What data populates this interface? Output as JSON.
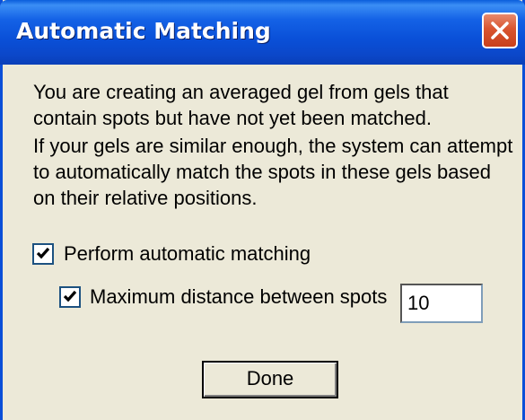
{
  "dialog": {
    "title": "Automatic Matching",
    "paragraph1_line1": "You are creating an averaged gel from gels that",
    "paragraph1_line2": "contain spots but have not yet been matched.",
    "paragraph2_line1": "If your gels are similar enough, the system can attempt",
    "paragraph2_line2": "to automatically match the spots in these gels based",
    "paragraph2_line3": "on their relative positions.",
    "auto_match_checkbox": {
      "label": "Perform automatic matching",
      "checked": true
    },
    "max_distance_checkbox": {
      "label": "Maximum distance between spots",
      "checked": true
    },
    "max_distance_value": "10",
    "done_label": "Done"
  },
  "colors": {
    "titlebar": "#0a50d8",
    "close_button": "#d9542f",
    "window_background": "#ece9d8"
  },
  "icons": {
    "close": "close-icon",
    "check": "checkmark-icon"
  }
}
